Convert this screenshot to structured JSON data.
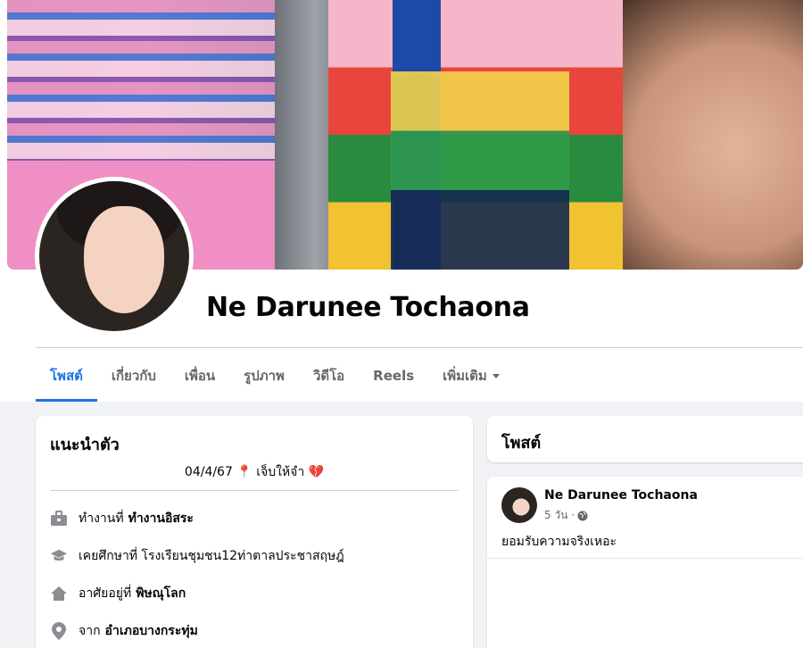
{
  "profile": {
    "name": "Ne Darunee Tochaona"
  },
  "tabs": [
    {
      "label": "โพสต์",
      "active": true
    },
    {
      "label": "เกี่ยวกับ",
      "active": false
    },
    {
      "label": "เพื่อน",
      "active": false
    },
    {
      "label": "รูปภาพ",
      "active": false
    },
    {
      "label": "วิดีโอ",
      "active": false
    },
    {
      "label": "Reels",
      "active": false
    },
    {
      "label": "เพิ่มเติม",
      "active": false
    }
  ],
  "intro": {
    "title": "แนะนำตัว",
    "bio": "04/4/67 📍 เจ็บให้จำ 💔",
    "rows": [
      {
        "icon": "briefcase-icon",
        "prefix": "ทำงานที่",
        "value": "ทำงานอิสระ"
      },
      {
        "icon": "graduation-cap-icon",
        "prefix": "เคยศึกษาที่ โรงเรียนชุมชน12ท่าตาลประชาสฤษฎ์",
        "value": ""
      },
      {
        "icon": "home-icon",
        "prefix": "อาศัยอยู่ที่",
        "value": "พิษณุโลก"
      },
      {
        "icon": "location-pin-icon",
        "prefix": "จาก",
        "value": "อำเภอบางกระทุ่ม"
      }
    ]
  },
  "posts": {
    "title": "โพสต์",
    "items": [
      {
        "author": "Ne Darunee Tochaona",
        "time": "5 วัน ·",
        "privacy_icon": "globe-icon",
        "text": "ยอมรับความจริงเหอะ"
      }
    ]
  },
  "colors": {
    "accent": "#1b74e4",
    "muted": "#65676b",
    "background": "#f0f2f5"
  }
}
